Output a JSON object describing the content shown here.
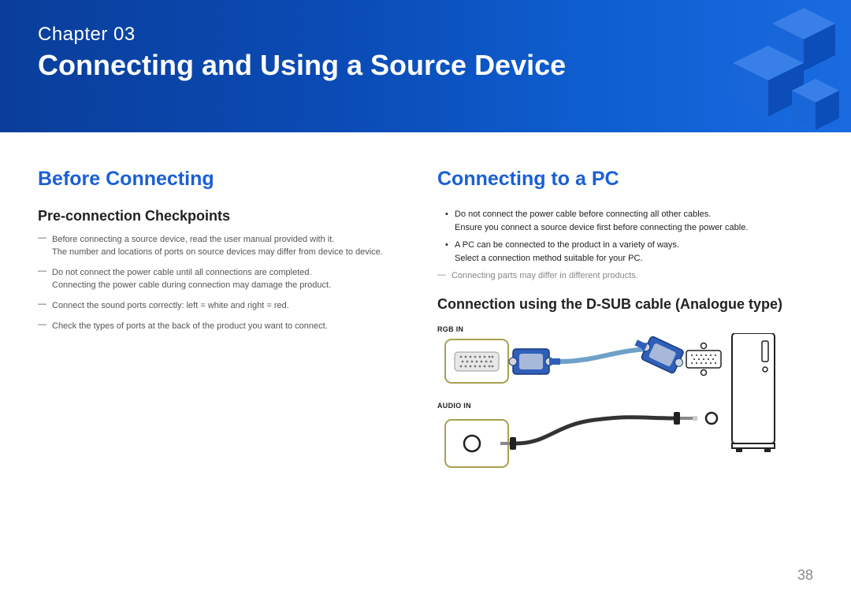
{
  "banner": {
    "chapter_label": "Chapter  03",
    "chapter_title": "Connecting and Using a Source Device"
  },
  "left": {
    "heading": "Before Connecting",
    "sub1": "Pre-connection Checkpoints",
    "items": [
      {
        "l1": "Before connecting a source device, read the user manual provided with it.",
        "l2": "The number and locations of ports on source devices may differ from device to device."
      },
      {
        "l1": "Do not connect the power cable until all connections are completed.",
        "l2": "Connecting the power cable during connection may damage the product."
      },
      {
        "l1": "Connect the sound ports correctly: left = white and right = red."
      },
      {
        "l1": "Check the types of ports at the back of the product you want to connect."
      }
    ]
  },
  "right": {
    "heading": "Connecting to a PC",
    "bullets": [
      {
        "l1": "Do not connect the power cable before connecting all other cables.",
        "l2": "Ensure you connect a source device first before connecting the power cable."
      },
      {
        "l1": "A PC can be connected to the product in a variety of ways.",
        "l2": "Select a connection method suitable for your PC."
      }
    ],
    "note": "Connecting parts may differ in different products.",
    "sub2": "Connection using the D-SUB cable (Analogue type)",
    "port_rgb": "RGB IN",
    "port_audio": "AUDIO IN"
  },
  "page_number": "38"
}
